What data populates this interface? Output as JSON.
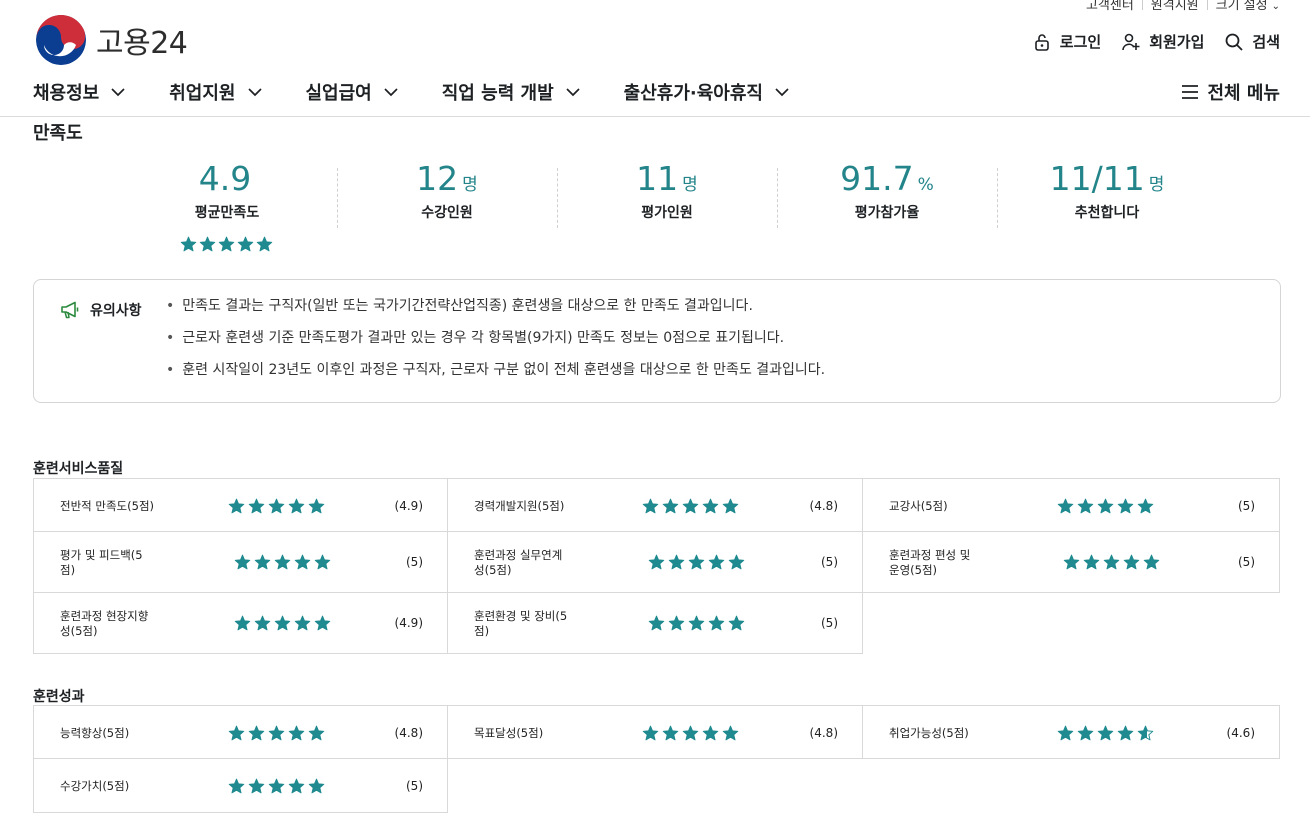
{
  "util": {
    "links": [
      "고객센터",
      "원격지원",
      "크기 설정"
    ]
  },
  "brand": {
    "name": "고용24"
  },
  "header_actions": {
    "login": "로그인",
    "signup": "회원가입",
    "search": "검색"
  },
  "nav": {
    "items": [
      "채용정보",
      "취업지원",
      "실업급여",
      "직업 능력 개발",
      "출산휴가·육아휴직"
    ],
    "all_menu": "전체 메뉴"
  },
  "section_title": "만족도",
  "stats": [
    {
      "value": "4.9",
      "unit": "",
      "label": "평균만족도",
      "stars": 4.9
    },
    {
      "value": "12",
      "unit": "명",
      "label": "수강인원"
    },
    {
      "value": "11",
      "unit": "명",
      "label": "평가인원"
    },
    {
      "value": "91.7",
      "unit": "%",
      "label": "평가참가율"
    },
    {
      "value": "11/11",
      "unit": "명",
      "label": "추천합니다"
    }
  ],
  "notice": {
    "title": "유의사항",
    "items": [
      "만족도 결과는 구직자(일반 또는 국가기간전략산업직종) 훈련생을 대상으로 한 만족도 결과입니다.",
      "근로자 훈련생 기준 만족도평가 결과만 있는 경우 각 항목별(9가지) 만족도 정보는 0점으로 표기됩니다.",
      "훈련 시작일이 23년도 이후인 과정은 구직자, 근로자 구분 없이 전체 훈련생을 대상으로 한 만족도 결과입니다."
    ]
  },
  "groups": [
    {
      "title": "훈련서비스품질",
      "items": [
        {
          "label": "전반적 만족도(5점)",
          "score": "(4.9)",
          "stars": 4.9
        },
        {
          "label": "경력개발지원(5점)",
          "score": "(4.8)",
          "stars": 4.8
        },
        {
          "label": "교강사(5점)",
          "score": "(5)",
          "stars": 5
        },
        {
          "label": "평가 및 피드백(5\n점)",
          "score": "(5)",
          "stars": 5
        },
        {
          "label": "훈련과정 실무연계\n성(5점)",
          "score": "(5)",
          "stars": 5
        },
        {
          "label": "훈련과정 편성 및\n운영(5점)",
          "score": "(5)",
          "stars": 5
        },
        {
          "label": "훈련과정 현장지향\n성(5점)",
          "score": "(4.9)",
          "stars": 4.9
        },
        {
          "label": "훈련환경 및 장비(5\n점)",
          "score": "(5)",
          "stars": 5
        }
      ]
    },
    {
      "title": "훈련성과",
      "items": [
        {
          "label": "능력향상(5점)",
          "score": "(4.8)",
          "stars": 4.8
        },
        {
          "label": "목표달성(5점)",
          "score": "(4.8)",
          "stars": 4.8
        },
        {
          "label": "취업가능성(5점)",
          "score": "(4.6)",
          "stars": 4.6
        },
        {
          "label": "수강가치(5점)",
          "score": "(5)",
          "stars": 5
        }
      ]
    }
  ],
  "colors": {
    "accent": "#23858a",
    "star": "#1f8a8f",
    "logo_blue": "#0b3d91",
    "logo_red": "#cd2e3a"
  }
}
